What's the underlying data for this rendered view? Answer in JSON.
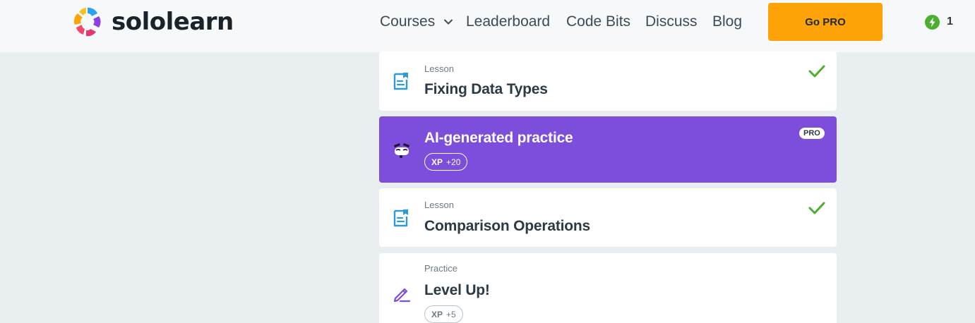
{
  "header": {
    "logo_text": "sololearn",
    "nav": {
      "courses": "Courses",
      "leaderboard": "Leaderboard",
      "code_bits": "Code Bits",
      "discuss": "Discuss",
      "blog": "Blog"
    },
    "go_pro": "Go PRO",
    "streak_count": "1"
  },
  "items": [
    {
      "kind": "Lesson",
      "title": "Fixing Data Types",
      "completed": true,
      "icon": "lesson-icon"
    },
    {
      "title": "AI-generated practice",
      "badge": "PRO",
      "xp_label": "XP",
      "xp_value": "+20",
      "icon": "ai-robot-icon"
    },
    {
      "kind": "Lesson",
      "title": "Comparison Operations",
      "completed": true,
      "icon": "lesson-icon"
    },
    {
      "kind": "Practice",
      "title": "Level Up!",
      "xp_label": "XP",
      "xp_value": "+5",
      "icon": "pencil-icon"
    }
  ],
  "colors": {
    "page_bg": "#e9eef1",
    "accent_pro": "#fda308",
    "ai_card": "#7d4ddb",
    "lesson_icon": "#2d9bd8",
    "check": "#4caf2f",
    "practice_icon": "#7d4ddb",
    "streak": "#4caf2f"
  }
}
